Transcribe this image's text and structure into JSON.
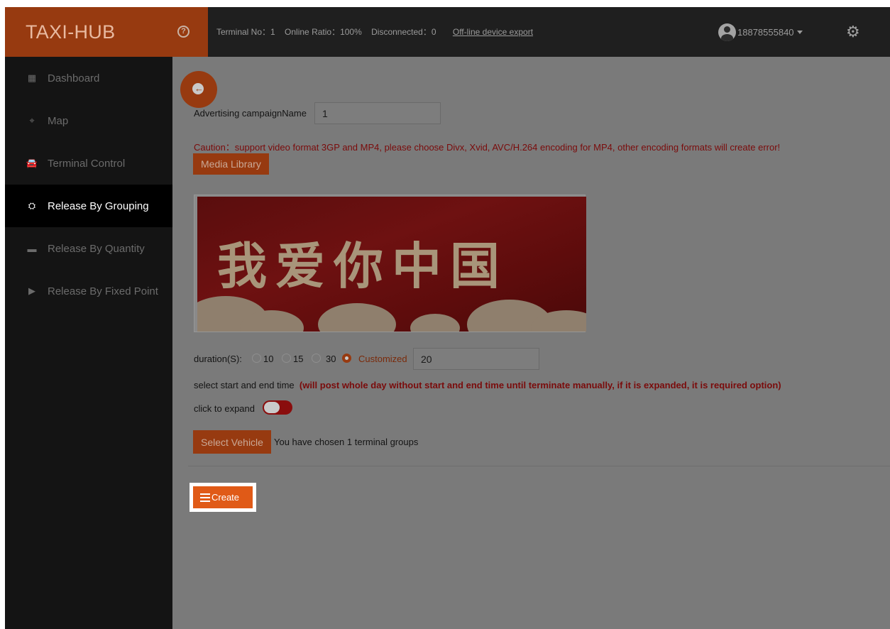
{
  "app": {
    "brand": "TAXI-HUB"
  },
  "header": {
    "terminal_no": "Terminal No：1",
    "online_ratio": "Online Ratio：100%",
    "disconnected": "Disconnected：0",
    "export_link": "Off-line device export",
    "user": "18878555840"
  },
  "sidebar": {
    "items": [
      {
        "label": "Dashboard",
        "icon": "dashboard-icon"
      },
      {
        "label": "Map",
        "icon": "map-icon"
      },
      {
        "label": "Terminal Control",
        "icon": "car-icon"
      },
      {
        "label": "Release By Grouping",
        "icon": "group-icon",
        "active": true
      },
      {
        "label": "Release By Quantity",
        "icon": "monitor-icon"
      },
      {
        "label": "Release By Fixed Point",
        "icon": "play-icon"
      }
    ]
  },
  "form": {
    "campaign_label": "Advertising campaignName",
    "campaign_value": "1",
    "caution": "Caution：support video format 3GP and MP4, please choose Divx, Xvid, AVC/H.264 encoding for MP4, other encoding formats will create error!",
    "media_library_label": "Media Library",
    "banner_text": "我爱你中国",
    "duration_label": "duration(S):",
    "duration_options": [
      "10",
      "15",
      "30",
      "Customized"
    ],
    "duration_selected": "Customized",
    "duration_value": "20",
    "time_label": "select start and end time",
    "time_note": "(will post whole day without start and end time until terminate manually, if it is expanded, it is required option)",
    "expand_label": "click to expand",
    "select_vehicle_label": "Select Vehicle",
    "chosen_text": "You have chosen 1 terminal groups",
    "create_label": "Create"
  },
  "colors": {
    "brand": "#973a10",
    "accent": "#e05a17",
    "warning_text": "#7a0b0b"
  }
}
